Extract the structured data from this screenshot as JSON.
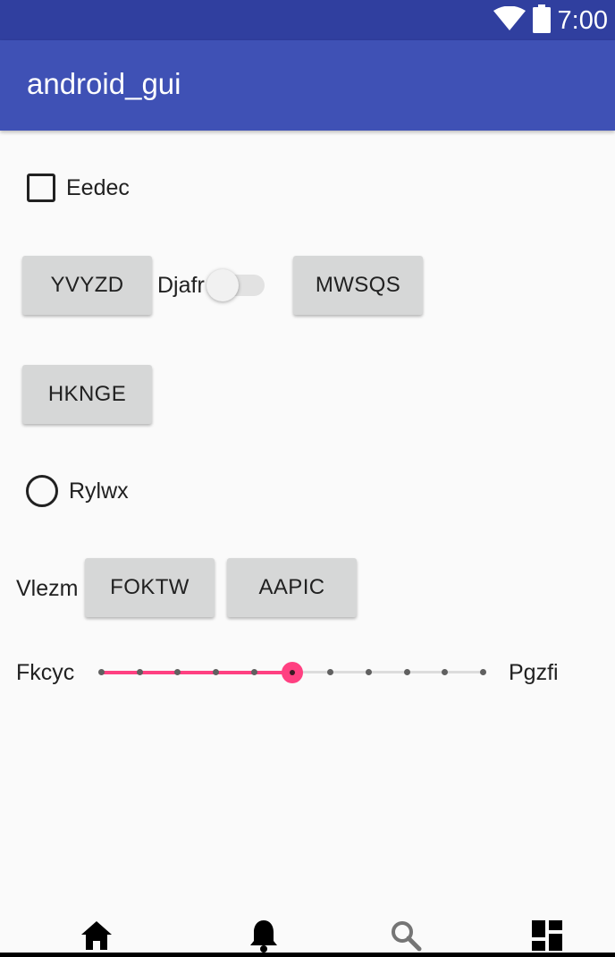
{
  "status_bar": {
    "time": "7:00",
    "icons": [
      "wifi-icon",
      "battery-icon"
    ],
    "color": "#303f9f"
  },
  "app_bar": {
    "title": "android_gui",
    "color": "#3f51b5"
  },
  "checkbox": {
    "label": "Eedec",
    "checked": false
  },
  "buttons": {
    "yvyzd": "YVYZD",
    "mwsqs": "MWSQS",
    "hknge": "HKNGE",
    "foktw": "FOKTW",
    "aapic": "AAPIC"
  },
  "switch": {
    "label": "Djafr",
    "checked": false
  },
  "radio": {
    "label": "Rylwx",
    "checked": false
  },
  "labels": {
    "vlezm": "Vlezm"
  },
  "slider": {
    "left_label": "Fkcyc",
    "right_label": "Pgzfi",
    "min": 0,
    "max": 10,
    "value": 5,
    "accent": "#ff4081"
  },
  "bottom_nav": {
    "items": [
      "home-icon",
      "bell-icon",
      "search-icon",
      "dashboard-icon"
    ]
  }
}
